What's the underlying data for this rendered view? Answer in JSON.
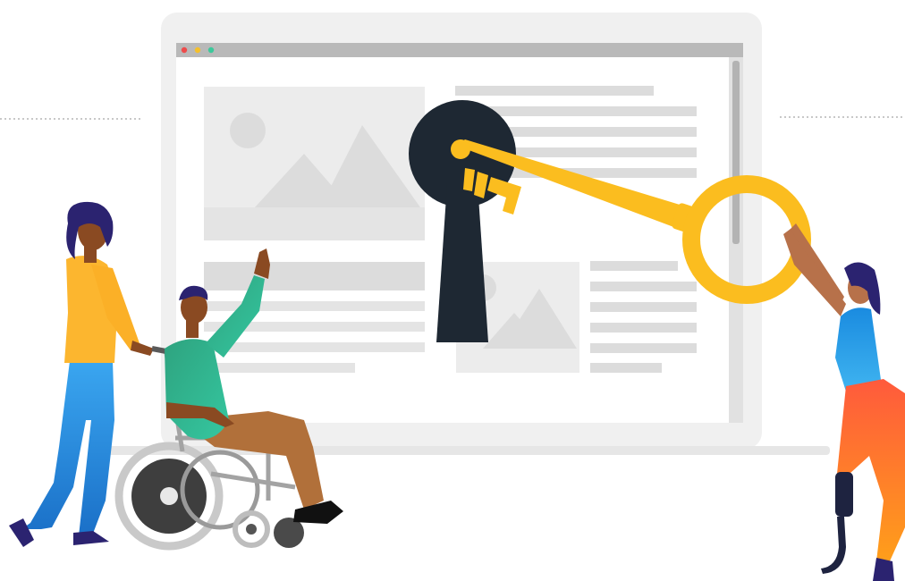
{
  "illustration": {
    "colors": {
      "background": "#ffffff",
      "monitor_frame": "#efefef",
      "screen": "#ffffff",
      "browser_bar": "#b8b8b8",
      "placeholder_light": "#ececec",
      "placeholder_mid": "#dcdcdc",
      "keyhole": "#1e2833",
      "key": "#fbbd1f",
      "dot_red": "#ee4b4b",
      "dot_yellow": "#f5c02b",
      "dot_green": "#3cc99b"
    },
    "icons": [
      "keyhole-icon",
      "key-icon",
      "image-placeholder-icon",
      "wheelchair-icon"
    ]
  }
}
